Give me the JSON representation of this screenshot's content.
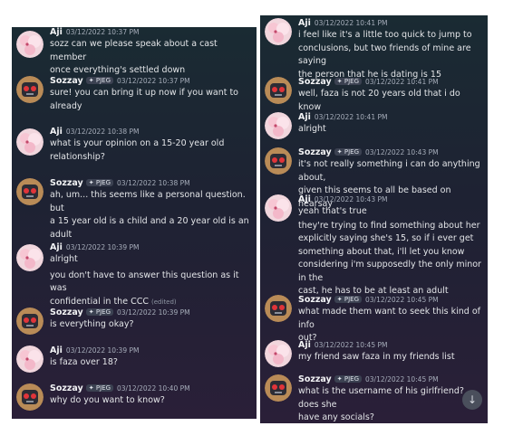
{
  "left_panel": {
    "messages": [
      {
        "author": "Aji",
        "time": "03/12/2022 10:37 PM",
        "lines": [
          "sozz can we please speak about a cast member",
          "once everything's settled down"
        ]
      },
      {
        "author": "Sozzay",
        "tag": "PJEG",
        "time": "03/12/2022 10:37 PM",
        "lines": [
          "sure! you can bring it up now if you want to",
          "already"
        ]
      },
      {
        "author": "Aji",
        "time": "03/12/2022 10:38 PM",
        "lines": [
          "what is your opinion on a 15-20 year old",
          "relationship?"
        ]
      },
      {
        "author": "Sozzay",
        "tag": "PJEG",
        "time": "03/12/2022 10:38 PM",
        "lines": [
          "ah, um... this seems like a personal question. but",
          "a 15 year old is a child and a 20 year old is an",
          "adult"
        ]
      },
      {
        "author": "Aji",
        "time": "03/12/2022 10:39 PM",
        "lines": [
          "alright",
          "you don't have to answer this question as it was",
          "confidential in the CCC"
        ],
        "edited": "(edited)"
      },
      {
        "author": "Sozzay",
        "tag": "PJEG",
        "time": "03/12/2022 10:39 PM",
        "lines": [
          "is everything okay?"
        ]
      },
      {
        "author": "Aji",
        "time": "03/12/2022 10:39 PM",
        "lines": [
          "is faza over 18?"
        ]
      },
      {
        "author": "Sozzay",
        "tag": "PJEG",
        "time": "03/12/2022 10:40 PM",
        "lines": [
          "why do you want to know?"
        ]
      }
    ]
  },
  "right_panel": {
    "messages": [
      {
        "author": "Aji",
        "time": "03/12/2022 10:41 PM",
        "lines": [
          "i feel like it's a little too quick to jump to",
          "conclusions, but two friends of mine are saying",
          "the person that he is dating is 15"
        ]
      },
      {
        "author": "Sozzay",
        "tag": "PJEG",
        "time": "03/12/2022 10:41 PM",
        "lines": [
          "well, faza is not 20 years old that i do know"
        ]
      },
      {
        "author": "Aji",
        "time": "03/12/2022 10:41 PM",
        "lines": [
          "alright"
        ]
      },
      {
        "author": "Sozzay",
        "tag": "PJEG",
        "time": "03/12/2022 10:43 PM",
        "lines": [
          "it's not really something i can do anything about,",
          "given this seems to all be based on hearsay"
        ]
      },
      {
        "author": "Aji",
        "time": "03/12/2022 10:43 PM",
        "lines": [
          "yeah that's true",
          "they're trying to find something about her",
          "explicitly saying she's 15, so if i ever get",
          "something about that, i'll let you know",
          "considering i'm supposedly the only minor in the",
          "cast, he has to be at least an adult"
        ]
      },
      {
        "author": "Sozzay",
        "tag": "PJEG",
        "time": "03/12/2022 10:45 PM",
        "lines": [
          "what made them want to seek this kind of info",
          "out?"
        ]
      },
      {
        "author": "Aji",
        "time": "03/12/2022 10:45 PM",
        "lines": [
          "my friend saw faza in my friends list"
        ]
      },
      {
        "author": "Sozzay",
        "tag": "PJEG",
        "time": "03/12/2022 10:45 PM",
        "lines": [
          "what is the username of his girlfriend? does she",
          "have any socials?"
        ]
      }
    ]
  },
  "icons": {
    "scroll_down": "arrow-down-icon",
    "role_tag": "diamond-icon",
    "aji_avatar": "pink-character-avatar",
    "sozzay_avatar": "robot-avatar"
  },
  "colors": {
    "name": "#f2f3f5",
    "text": "#e3e5e8",
    "timestamp": "#a6adba",
    "tag_bg": "#3b4151"
  }
}
